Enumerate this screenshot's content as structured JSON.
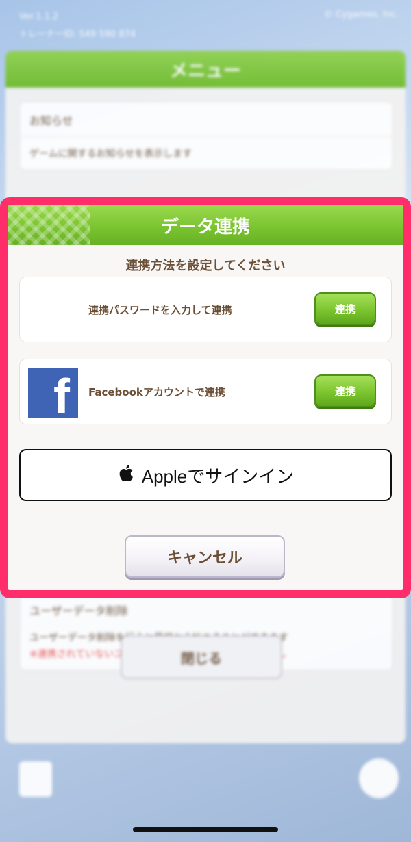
{
  "background": {
    "version": "Ver.1.1.2",
    "trainer_id": "トレーナーID: 549 590 874",
    "copyright": "© Cygames, Inc.",
    "menu": {
      "title": "メニュー",
      "items": [
        {
          "title": "お知らせ",
          "desc": "ゲームに関するお知らせを表示します"
        }
      ],
      "delete_item": {
        "title": "ユーザーデータ削除",
        "desc": "ユーザーデータ削除を行うと最初から始めることができます",
        "warning": "※連携されていないユーザーデータは戻すことができません"
      },
      "close_label": "閉じる"
    }
  },
  "dialog": {
    "title": "データ連携",
    "subtitle": "連携方法を設定してください",
    "options": [
      {
        "label": "連携パスワードを入力して連携",
        "button": "連携"
      },
      {
        "label": "Facebookアカウントで連携",
        "button": "連携",
        "icon": "facebook-icon"
      }
    ],
    "apple_button": {
      "label": "Appleでサインイン",
      "icon": "apple-icon"
    },
    "cancel_label": "キャンセル"
  },
  "colors": {
    "highlight_border": "#ff2e6a",
    "header_green": "#78c22f",
    "text_brown": "#6b4f37",
    "facebook_blue": "#3f63b5"
  }
}
